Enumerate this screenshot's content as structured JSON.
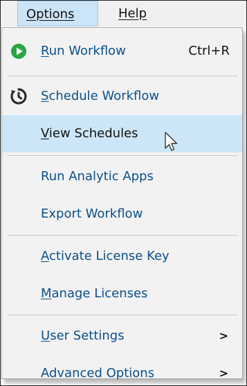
{
  "menubar": {
    "items": [
      {
        "label": "Options",
        "accel": "O",
        "rest": "ptions",
        "active": true
      },
      {
        "label": "Help",
        "accel": "H",
        "rest": "elp",
        "active": false
      }
    ]
  },
  "menu": {
    "items": [
      {
        "label": "Run Workflow",
        "accel": "R",
        "rest": "un Workflow",
        "shortcut": "Ctrl+R",
        "icon": "play-icon",
        "icon_color": "#2aa641"
      },
      {
        "label": "Schedule Workflow",
        "accel": "S",
        "rest": "chedule Workflow",
        "icon": "schedule-clock-icon"
      },
      {
        "label": "View Schedules",
        "accel": "V",
        "rest": "iew Schedules",
        "highlighted": true
      },
      {
        "label": "Run Analytic Apps"
      },
      {
        "label": "Export Workflow"
      },
      {
        "label": "Activate License Key",
        "accel": "A",
        "rest": "ctivate License Key"
      },
      {
        "label": "Manage Licenses",
        "accel": "M",
        "rest": "anage Licenses"
      },
      {
        "label": "User Settings",
        "accel": "U",
        "rest": "ser Settings",
        "submenu": ">"
      },
      {
        "label": "Advanced Options",
        "submenu": ">"
      }
    ]
  },
  "colors": {
    "menu_text": "#0b4f8a",
    "highlight_bg": "#cde6f7",
    "menubar_active_bg": "#cce4f7",
    "menu_bg": "#f2f2f2"
  }
}
